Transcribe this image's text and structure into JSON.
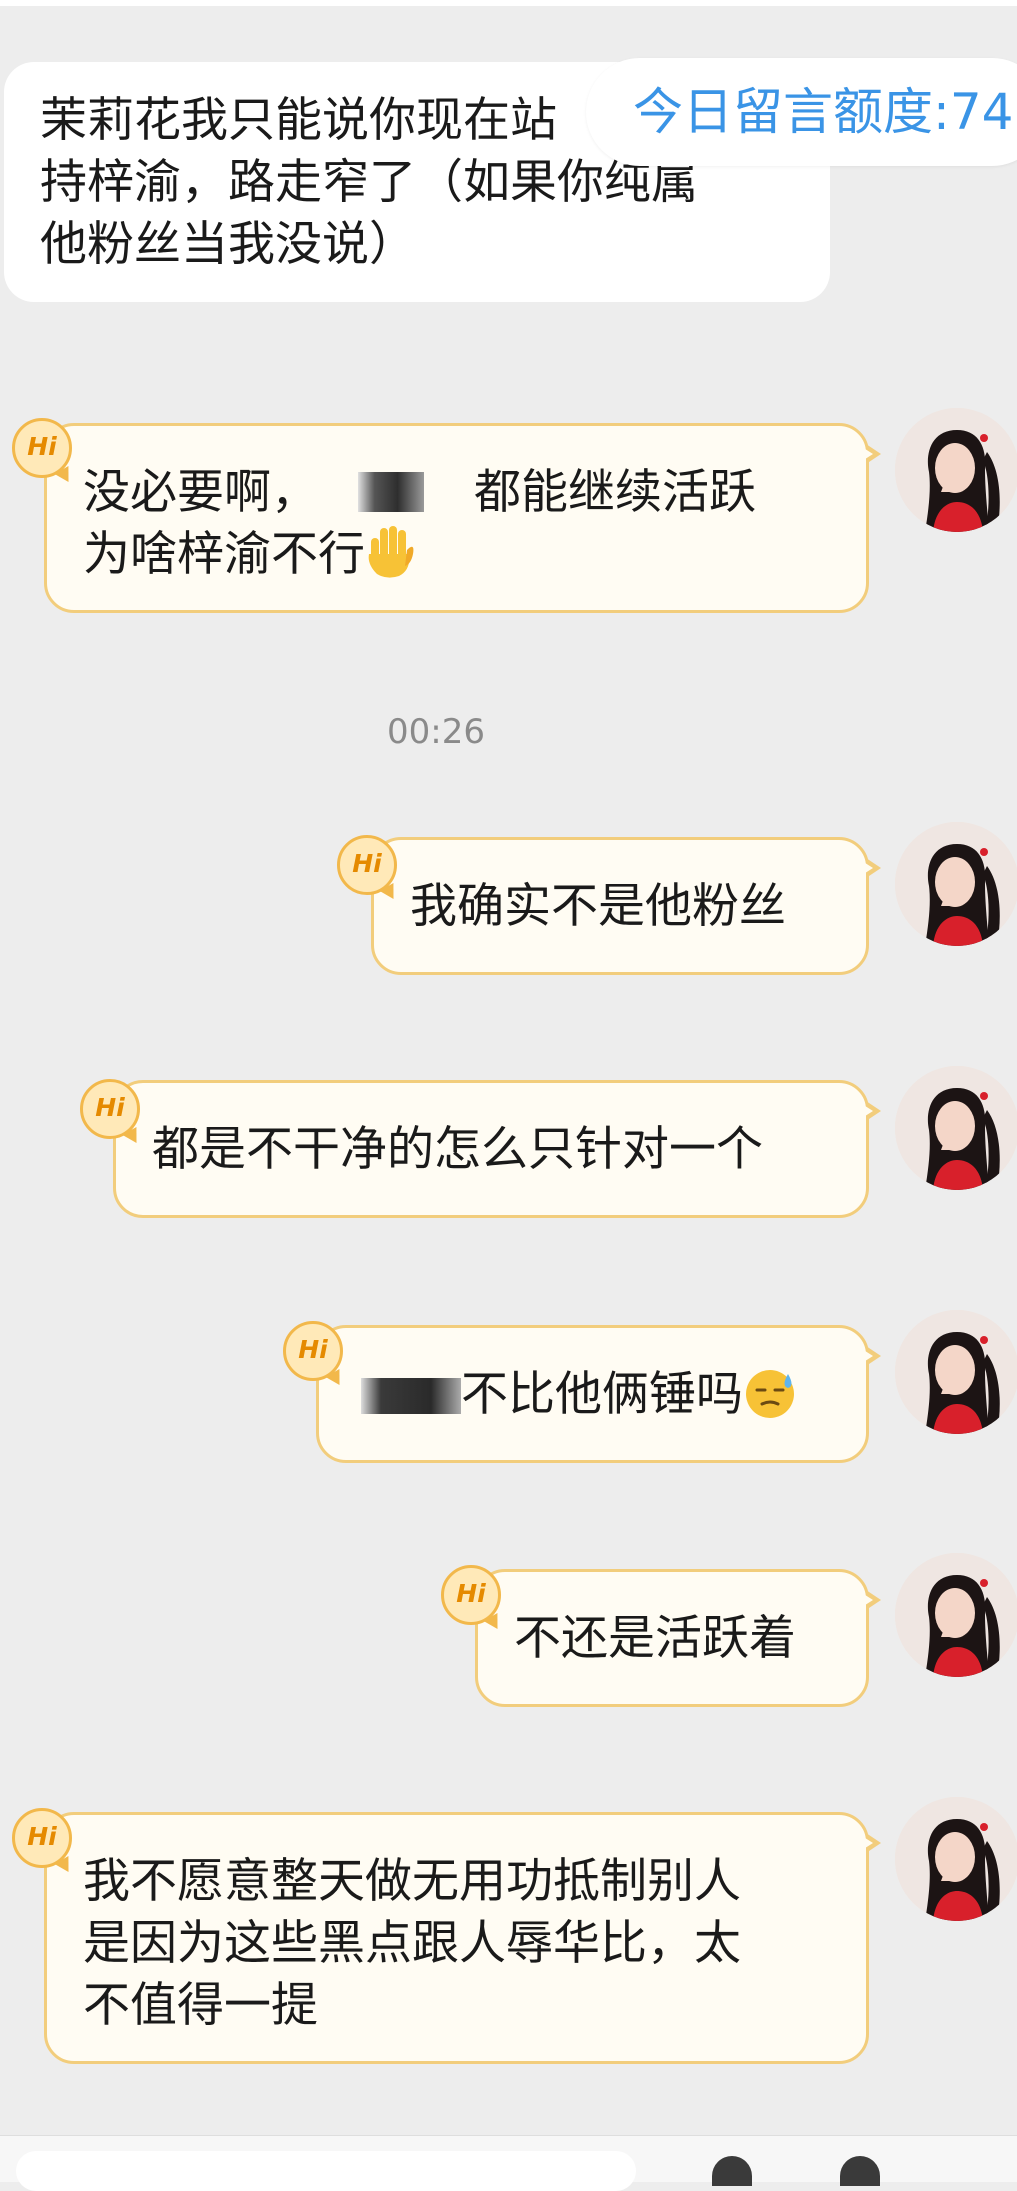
{
  "quota": {
    "label": "今日留言额度:74"
  },
  "incoming": {
    "lines": [
      "茉莉花我只能说你现在站",
      "持梓渝，路走窄了（如果你纯属",
      "他粉丝当我没说）"
    ]
  },
  "timestamp": "00:26",
  "messages": [
    {
      "line1_prefix": "没必要啊，",
      "line1_suffix": "都能继续活跃",
      "line2": "为啥梓渝不行"
    },
    {
      "text": "我确实不是他粉丝"
    },
    {
      "text": "都是不干净的怎么只针对一个"
    },
    {
      "text": "不比他俩锤吗"
    },
    {
      "text": "不还是活跃着"
    },
    {
      "lines": [
        "我不愿意整天做无用功抵制别人",
        "是因为这些黑点跟人辱华比，太",
        "不值得一提"
      ]
    }
  ],
  "badge": "Hi",
  "icons": {
    "hand": "raised-hand-emoji",
    "face": "downcast-face-with-sweat-emoji",
    "badge": "hi-badge-icon",
    "avatar": "user-avatar"
  },
  "colors": {
    "background": "#ededed",
    "bubble_fill": "#fffcf3",
    "bubble_border": "#f2cd7c",
    "quota_text": "#3a94e6",
    "timestamp": "#8a8a8a"
  }
}
